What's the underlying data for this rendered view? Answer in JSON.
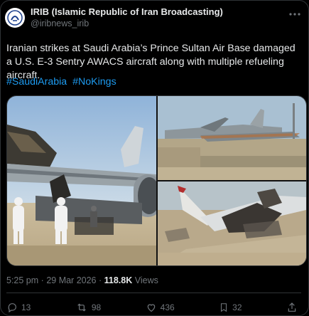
{
  "author": {
    "display_name": "IRIB (Islamic Republic of Iran Broadcasting)",
    "handle": "@iribnews_irib"
  },
  "post": {
    "text": "Iranian strikes at Saudi Arabia’s Prince Sultan Air Base damaged a U.S. E-3 Sentry AWACS aircraft along with multiple refueling aircraft.",
    "hashtags": [
      "#SaudiArabia",
      "#NoKings"
    ]
  },
  "meta": {
    "time": "5:25 pm",
    "separator": "·",
    "date": "29 Mar 2026",
    "views_count": "118.8K",
    "views_label": "Views"
  },
  "actions": {
    "replies": "13",
    "reposts": "98",
    "likes": "436",
    "bookmarks": "32"
  },
  "colors": {
    "background": "#000000",
    "text": "#e7e9ea",
    "secondary_text": "#71767b",
    "link": "#1d9bf0",
    "border": "#2f3336"
  },
  "icons": [
    "more-icon",
    "reply-icon",
    "repost-icon",
    "like-icon",
    "bookmark-icon",
    "share-icon"
  ]
}
